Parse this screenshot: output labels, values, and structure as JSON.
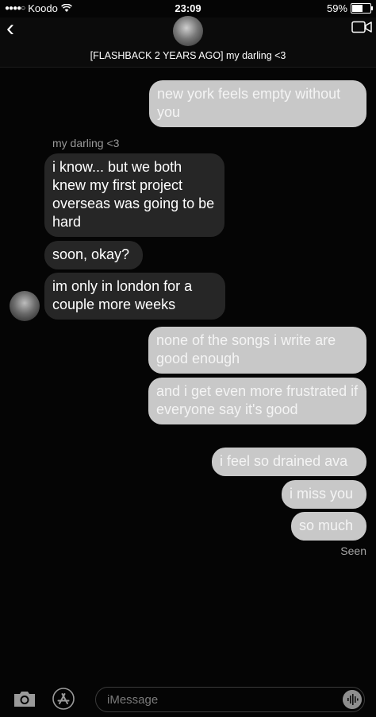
{
  "status_bar": {
    "signal": "●●●●○",
    "carrier": "Koodo",
    "time": "23:09",
    "battery": "59%",
    "battery_level": 0.59
  },
  "header": {
    "title": "[FLASHBACK 2 YEARS AGO] my darling <3"
  },
  "thread": {
    "sender_name": "my darling <3",
    "messages": [
      {
        "type": "sent",
        "text": "new york feels empty without you"
      },
      {
        "type": "received",
        "text": "i know... but we both knew my first project overseas was going to be hard"
      },
      {
        "type": "received",
        "text": "soon, okay?"
      },
      {
        "type": "received",
        "text": "im only in london for a couple more weeks"
      },
      {
        "type": "sent",
        "text": "none of the songs i write are good enough"
      },
      {
        "type": "sent",
        "text": "and i get even more frustrated if everyone say it's good"
      },
      {
        "type": "sent",
        "text": "i feel so drained ava"
      },
      {
        "type": "sent",
        "text": "i miss you"
      },
      {
        "type": "sent",
        "text": "so much"
      }
    ],
    "read_receipt": "Seen"
  },
  "input": {
    "placeholder": "iMessage"
  },
  "icons": {
    "back": "chevron-left-icon",
    "video": "video-camera-icon",
    "camera": "camera-icon",
    "apps": "app-store-icon",
    "audio": "audio-waveform-icon"
  },
  "colors": {
    "background": "#050505",
    "sent_bubble": "#c8c8c8",
    "received_bubble": "#262626"
  }
}
